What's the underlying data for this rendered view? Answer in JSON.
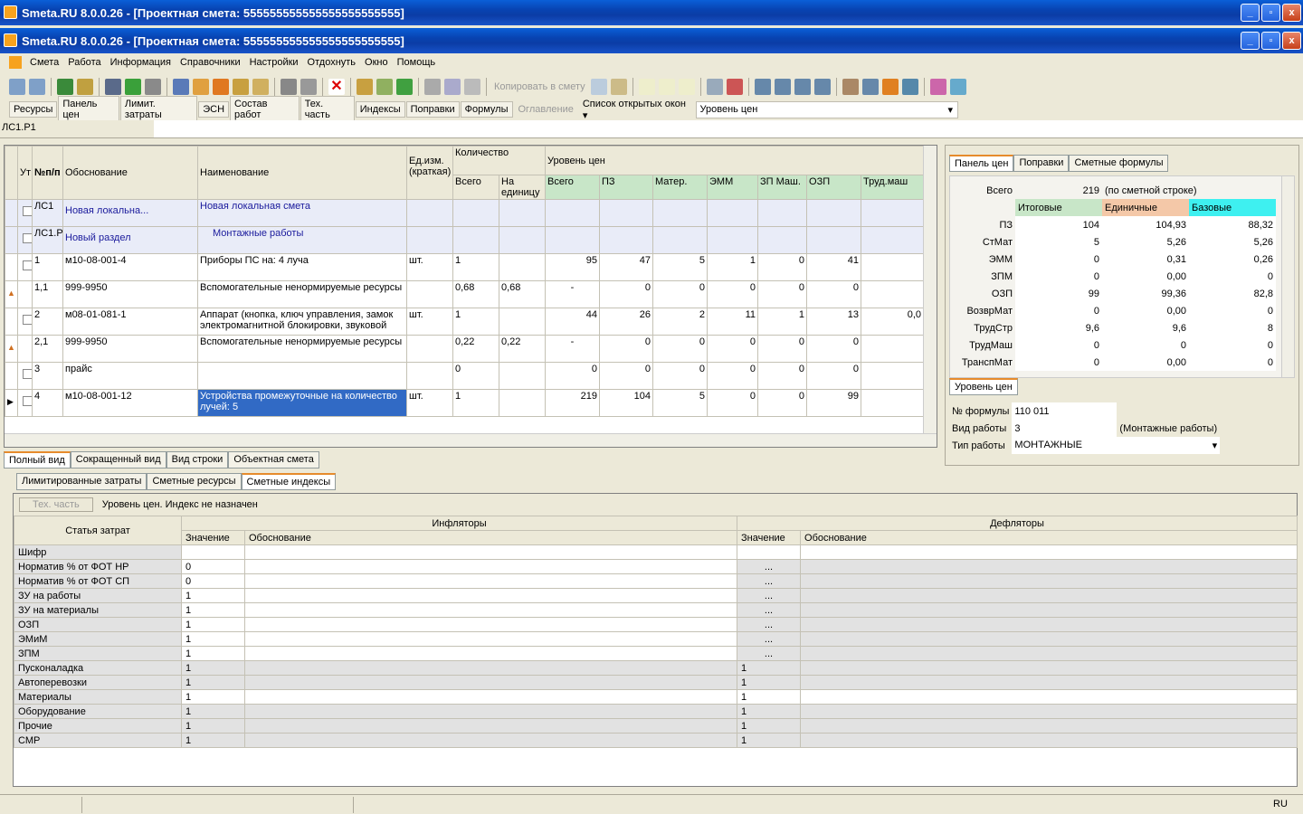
{
  "window": {
    "title": "Smeta.RU  8.0.0.26   - [Проектная смета: 555555555555555555555555]",
    "btn_min": "_",
    "btn_max": "▫",
    "btn_close": "x"
  },
  "menu": [
    "Смета",
    "Работа",
    "Информация",
    "Справочники",
    "Настройки",
    "Отдохнуть",
    "Окно",
    "Помощь"
  ],
  "toolbar": {
    "copy_label": "Копировать в смету"
  },
  "tabs": [
    "Ресурсы",
    "Панель цен",
    "Лимит. затраты",
    "ЭСН",
    "Состав работ",
    "Тех. часть",
    "Индексы",
    "Поправки",
    "Формулы"
  ],
  "tabs_disabled": "Оглавление",
  "open_windows": "Список открытых окон",
  "price_level_select": "Уровень цен",
  "address": "ЛС1.Р1",
  "grid": {
    "headers": {
      "ut": "Ут",
      "num": "№п/п",
      "basis": "Обоснование",
      "name": "Наименование",
      "unit": "Ед.изм. (краткая)",
      "qty": "Количество",
      "qty_total": "Всего",
      "qty_unit": "На единицу",
      "level": "Уровень цен",
      "total": "Всего",
      "pz": "ПЗ",
      "mat": "Матер.",
      "emm": "ЭММ",
      "zpm": "ЗП Маш.",
      "ozp": "ОЗП",
      "trud": "Труд.маш"
    },
    "rows": [
      {
        "num": "ЛС1",
        "basis": "Новая локальна...",
        "name": "Новая локальная смета",
        "type": "ls"
      },
      {
        "num": "ЛС1.Р",
        "basis": "Новый раздел",
        "name": "Монтажные работы",
        "type": "sec"
      },
      {
        "num": "1",
        "basis": "м10-08-001-4",
        "name": "Приборы ПС на: 4 луча",
        "unit": "шт.",
        "qty": "1",
        "qu": "",
        "total": "95",
        "pz": "47",
        "mat": "5",
        "emm": "1",
        "zpm": "0",
        "ozp": "41",
        "trud": ""
      },
      {
        "num": "1,1",
        "basis": "999-9950",
        "name": "Вспомогательные ненормируемые ресурсы",
        "unit": "",
        "qty": "0,68",
        "qu": "0,68",
        "total": "-",
        "pz": "0",
        "mat": "0",
        "emm": "0",
        "zpm": "0",
        "ozp": "0",
        "trud": ""
      },
      {
        "num": "2",
        "basis": "м08-01-081-1",
        "name": "Аппарат (кнопка, ключ управления, замок электромагнитной блокировки, звуковой",
        "unit": "шт.",
        "qty": "1",
        "qu": "",
        "total": "44",
        "pz": "26",
        "mat": "2",
        "emm": "11",
        "zpm": "1",
        "ozp": "13",
        "trud": "0,0"
      },
      {
        "num": "2,1",
        "basis": "999-9950",
        "name": "Вспомогательные ненормируемые ресурсы",
        "unit": "",
        "qty": "0,22",
        "qu": "0,22",
        "total": "-",
        "pz": "0",
        "mat": "0",
        "emm": "0",
        "zpm": "0",
        "ozp": "0",
        "trud": ""
      },
      {
        "num": "3",
        "basis": "прайс",
        "name": "",
        "unit": "",
        "qty": "0",
        "qu": "",
        "total": "0",
        "pz": "0",
        "mat": "0",
        "emm": "0",
        "zpm": "0",
        "ozp": "0",
        "trud": ""
      },
      {
        "num": "4",
        "basis": "м10-08-001-12",
        "name": "Устройства промежуточные на количество лучей: 5",
        "unit": "шт.",
        "qty": "1",
        "qu": "",
        "total": "219",
        "pz": "104",
        "mat": "5",
        "emm": "0",
        "zpm": "0",
        "ozp": "99",
        "trud": ""
      }
    ]
  },
  "view_tabs": [
    "Полный вид",
    "Сокращенный вид",
    "Вид строки",
    "Объектная смета"
  ],
  "right_panel": {
    "tabs": [
      "Панель цен",
      "Поправки",
      "Сметные формулы"
    ],
    "total_label": "Всего",
    "total_value": "219",
    "total_note": "(по сметной строке)",
    "cols": [
      "Итоговые",
      "Единичные",
      "Базовые"
    ],
    "rows": [
      [
        "ПЗ",
        "104",
        "104,93",
        "88,32"
      ],
      [
        "СтМат",
        "5",
        "5,26",
        "5,26"
      ],
      [
        "ЭММ",
        "0",
        "0,31",
        "0,26"
      ],
      [
        "ЗПМ",
        "0",
        "0,00",
        "0"
      ],
      [
        "ОЗП",
        "99",
        "99,36",
        "82,8"
      ],
      [
        "ВозврМат",
        "0",
        "0,00",
        "0"
      ],
      [
        "ТрудСтр",
        "9,6",
        "9,6",
        "8"
      ],
      [
        "ТрудМаш",
        "0",
        "0",
        "0"
      ],
      [
        "ТранспМат",
        "0",
        "0,00",
        "0"
      ]
    ],
    "bottom_tab": "Уровень цен",
    "formula_label": "№ формулы",
    "formula_value": "110 011",
    "worktype_label": "Вид работы",
    "worktype_value": "3",
    "worktype_note": "(Монтажные работы)",
    "worktype2_label": "Тип работы",
    "worktype2_value": "МОНТАЖНЫЕ"
  },
  "lower": {
    "tabs": [
      "Лимитированные затраты",
      "Сметные ресурсы",
      "Сметные индексы"
    ],
    "tech_btn": "Тех. часть",
    "status": "Уровень цен. Индекс не назначен",
    "h_cost": "Статья затрат",
    "h_infl": "Инфляторы",
    "h_defl": "Дефляторы",
    "h_val": "Значение",
    "h_basis": "Обоснование",
    "rows": [
      [
        "Шифр",
        "",
        "",
        false
      ],
      [
        "Норматив % от ФОТ НР",
        "0",
        "...",
        false
      ],
      [
        "Норматив % от ФОТ СП",
        "0",
        "...",
        false
      ],
      [
        "ЗУ на работы",
        "1",
        "...",
        false
      ],
      [
        "ЗУ на материалы",
        "1",
        "...",
        false
      ],
      [
        "ОЗП",
        "1",
        "...",
        false
      ],
      [
        "ЭМиМ",
        "1",
        "...",
        false
      ],
      [
        "ЗПМ",
        "1",
        "...",
        false
      ],
      [
        "Пусконаладка",
        "1",
        "1",
        true
      ],
      [
        "Автоперевозки",
        "1",
        "1",
        true
      ],
      [
        "Материалы",
        "1",
        "1",
        false
      ],
      [
        "Оборудование",
        "1",
        "1",
        true
      ],
      [
        "Прочие",
        "1",
        "1",
        true
      ],
      [
        "СМР",
        "1",
        "1",
        true
      ]
    ]
  },
  "status": {
    "lang": "RU"
  }
}
